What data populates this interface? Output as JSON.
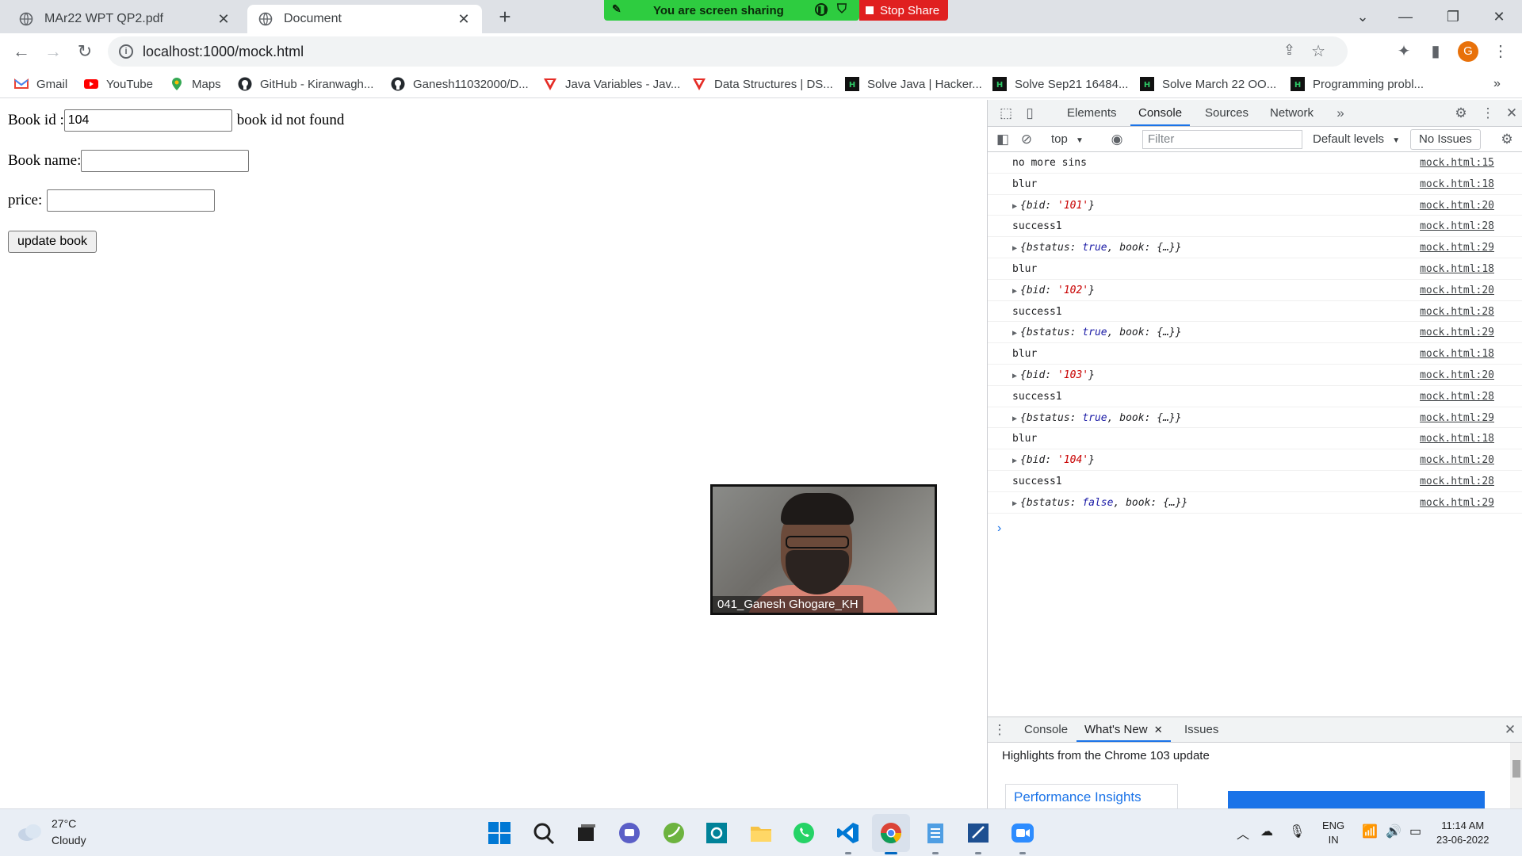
{
  "tabs": [
    {
      "title": "MAr22 WPT QP2.pdf",
      "active": false
    },
    {
      "title": "Document",
      "active": true
    }
  ],
  "screen_share": {
    "status": "You are screen sharing",
    "stop_label": "Stop Share"
  },
  "address": {
    "url": "localhost:1000/mock.html"
  },
  "profile_initial": "G",
  "bookmarks": [
    {
      "label": "Gmail",
      "icon": "gmail-icon"
    },
    {
      "label": "YouTube",
      "icon": "youtube-icon"
    },
    {
      "label": "Maps",
      "icon": "maps-icon"
    },
    {
      "label": "GitHub - Kiranwagh...",
      "icon": "github-icon"
    },
    {
      "label": "Ganesh11032000/D...",
      "icon": "github-icon"
    },
    {
      "label": "Java Variables - Jav...",
      "icon": "tpoint-icon"
    },
    {
      "label": "Data Structures | DS...",
      "icon": "tpoint-icon"
    },
    {
      "label": "Solve Java | Hacker...",
      "icon": "hackerrank-icon"
    },
    {
      "label": "Solve Sep21 16484...",
      "icon": "hackerrank-icon"
    },
    {
      "label": "Solve March 22 OO...",
      "icon": "hackerrank-icon"
    },
    {
      "label": "Programming probl...",
      "icon": "hackerrank-icon"
    }
  ],
  "form": {
    "book_id_label": "Book id :",
    "book_id_value": "104",
    "book_id_message": "book id not found",
    "book_name_label": "Book name:",
    "book_name_value": "",
    "price_label": "price:",
    "price_value": "",
    "update_button": "update book"
  },
  "video": {
    "participant": "041_Ganesh Ghogare_KH"
  },
  "devtools": {
    "tabs": [
      "Elements",
      "Console",
      "Sources",
      "Network"
    ],
    "active_tab": "Console",
    "context": "top",
    "filter_placeholder": "Filter",
    "levels": "Default levels",
    "issues": "No Issues",
    "console": [
      {
        "kind": "text",
        "text": "no more sins",
        "src": "mock.html:15"
      },
      {
        "kind": "text",
        "text": "blur",
        "src": "mock.html:18"
      },
      {
        "kind": "bid",
        "val": "'101'",
        "src": "mock.html:20"
      },
      {
        "kind": "text",
        "text": "success1",
        "src": "mock.html:28"
      },
      {
        "kind": "status",
        "val": "true",
        "src": "mock.html:29"
      },
      {
        "kind": "text",
        "text": "blur",
        "src": "mock.html:18"
      },
      {
        "kind": "bid",
        "val": "'102'",
        "src": "mock.html:20"
      },
      {
        "kind": "text",
        "text": "success1",
        "src": "mock.html:28"
      },
      {
        "kind": "status",
        "val": "true",
        "src": "mock.html:29"
      },
      {
        "kind": "text",
        "text": "blur",
        "src": "mock.html:18"
      },
      {
        "kind": "bid",
        "val": "'103'",
        "src": "mock.html:20"
      },
      {
        "kind": "text",
        "text": "success1",
        "src": "mock.html:28"
      },
      {
        "kind": "status",
        "val": "true",
        "src": "mock.html:29"
      },
      {
        "kind": "text",
        "text": "blur",
        "src": "mock.html:18"
      },
      {
        "kind": "bid",
        "val": "'104'",
        "src": "mock.html:20"
      },
      {
        "kind": "text",
        "text": "success1",
        "src": "mock.html:28"
      },
      {
        "kind": "status",
        "val": "false",
        "src": "mock.html:29"
      }
    ],
    "drawer_tabs": [
      "Console",
      "What's New",
      "Issues"
    ],
    "drawer_active": "What's New",
    "highlights": "Highlights from the Chrome 103 update",
    "perf_card": "Performance Insights"
  },
  "taskbar": {
    "temperature": "27°C",
    "condition": "Cloudy",
    "lang_line1": "ENG",
    "lang_line2": "IN",
    "time": "11:14 AM",
    "date": "23-06-2022"
  }
}
